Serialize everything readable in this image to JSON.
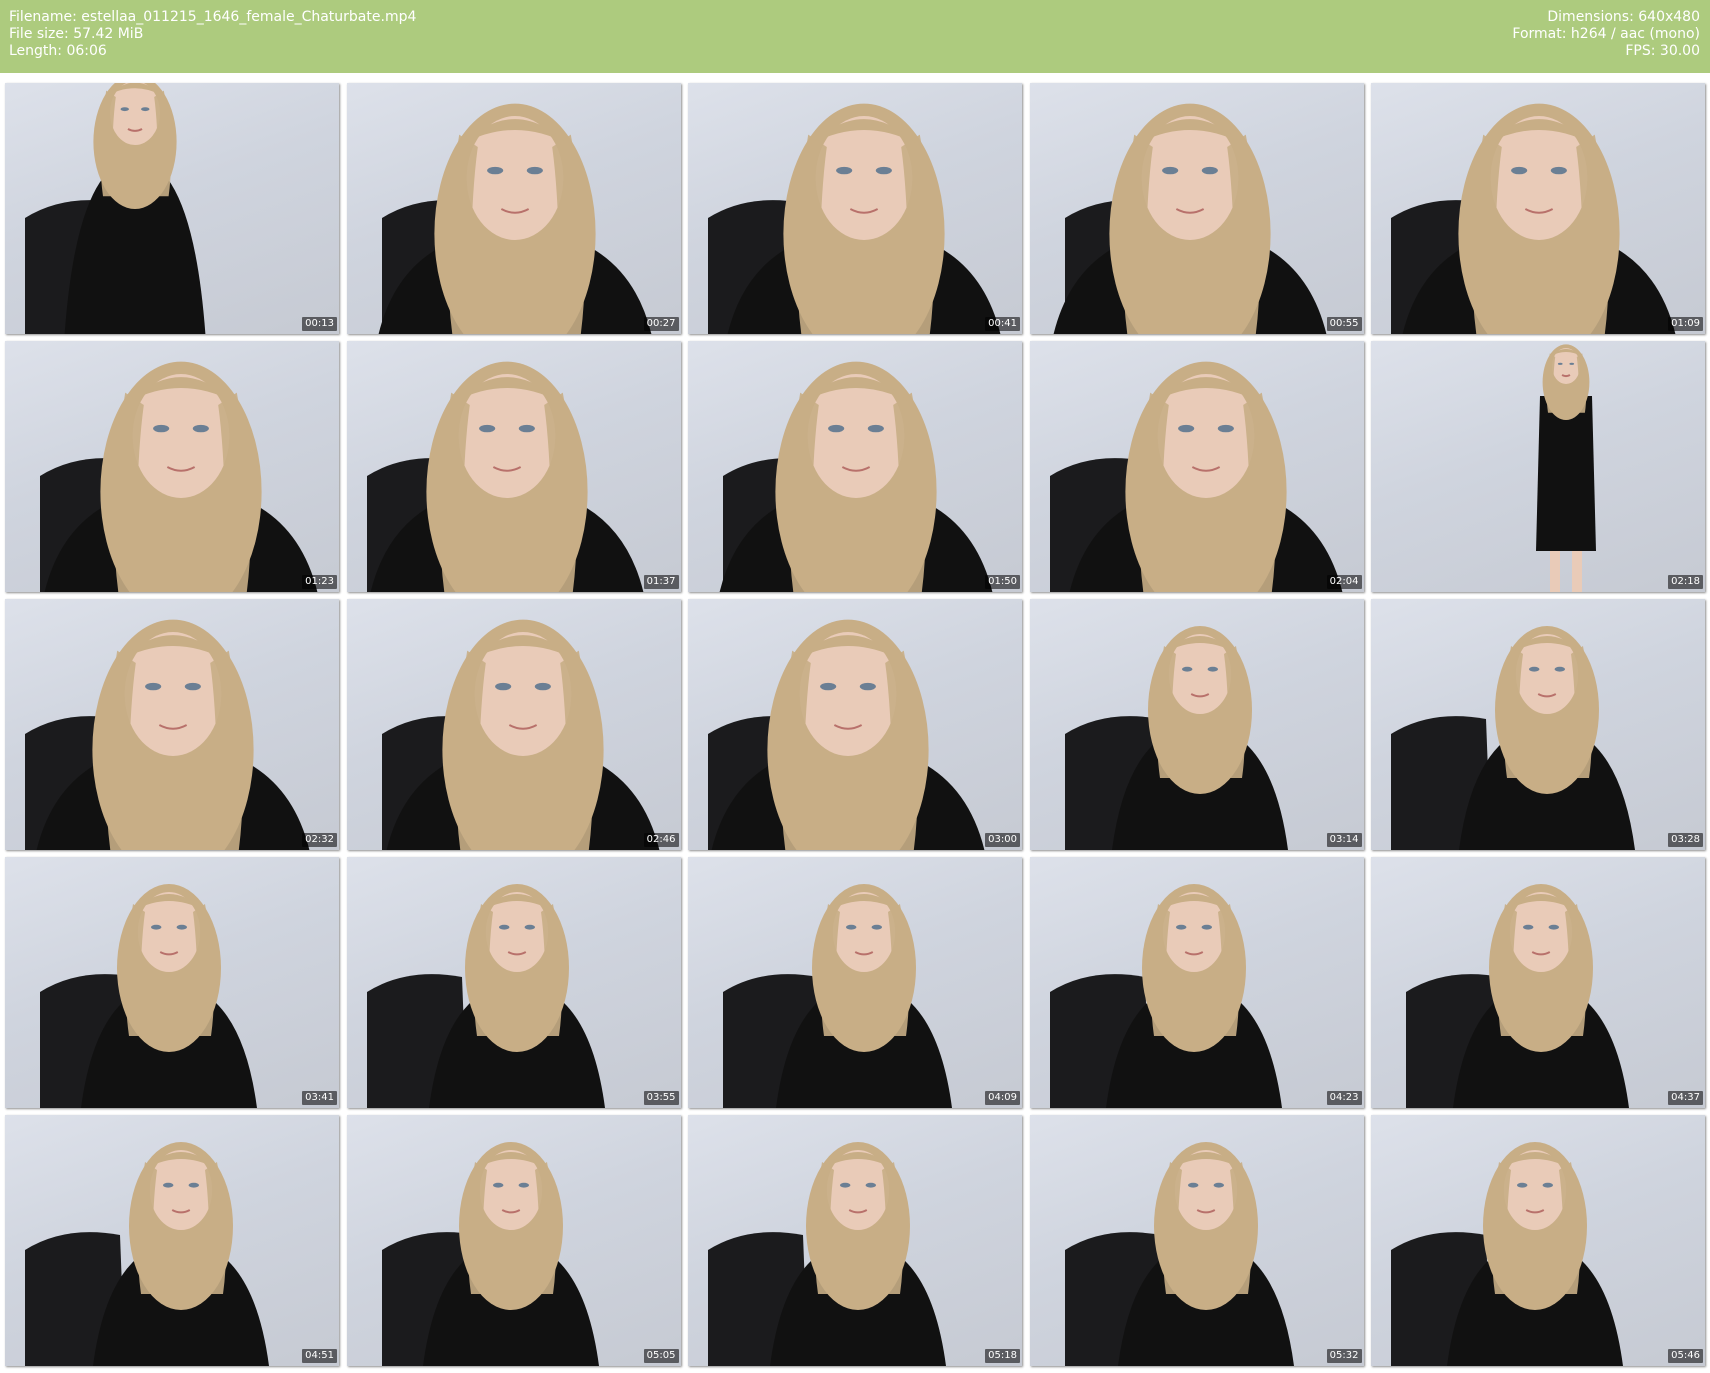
{
  "header": {
    "filename": "Filename: estellaa_011215_1646_female_Chaturbate.mp4",
    "filesize": "File size: 57.42 MiB",
    "length": "Length: 06:06",
    "dimensions": "Dimensions: 640x480",
    "format": "Format: h264 / aac (mono)",
    "fps": "FPS: 30.00"
  },
  "colors": {
    "header_bg": "#adcb7e",
    "header_text": "#ffffff",
    "hair": "#c8ae86",
    "shirt": "#111111",
    "skin": "#e9cbb8",
    "chair": "#1b1b1d"
  },
  "thumbnails": [
    {
      "time": "00:13",
      "pose": "far"
    },
    {
      "time": "00:27",
      "pose": "close"
    },
    {
      "time": "00:41",
      "pose": "close"
    },
    {
      "time": "00:55",
      "pose": "close"
    },
    {
      "time": "01:09",
      "pose": "close"
    },
    {
      "time": "01:23",
      "pose": "close"
    },
    {
      "time": "01:37",
      "pose": "close"
    },
    {
      "time": "01:50",
      "pose": "close"
    },
    {
      "time": "02:04",
      "pose": "close"
    },
    {
      "time": "02:18",
      "pose": "standing"
    },
    {
      "time": "02:32",
      "pose": "close"
    },
    {
      "time": "02:46",
      "pose": "close"
    },
    {
      "time": "03:00",
      "pose": "close"
    },
    {
      "time": "03:14",
      "pose": "seated"
    },
    {
      "time": "03:28",
      "pose": "seated"
    },
    {
      "time": "03:41",
      "pose": "seated"
    },
    {
      "time": "03:55",
      "pose": "seated"
    },
    {
      "time": "04:09",
      "pose": "seated"
    },
    {
      "time": "04:23",
      "pose": "seated"
    },
    {
      "time": "04:37",
      "pose": "seated"
    },
    {
      "time": "04:51",
      "pose": "seated"
    },
    {
      "time": "05:05",
      "pose": "seated"
    },
    {
      "time": "05:18",
      "pose": "seated"
    },
    {
      "time": "05:32",
      "pose": "seated"
    },
    {
      "time": "05:46",
      "pose": "seated"
    }
  ]
}
